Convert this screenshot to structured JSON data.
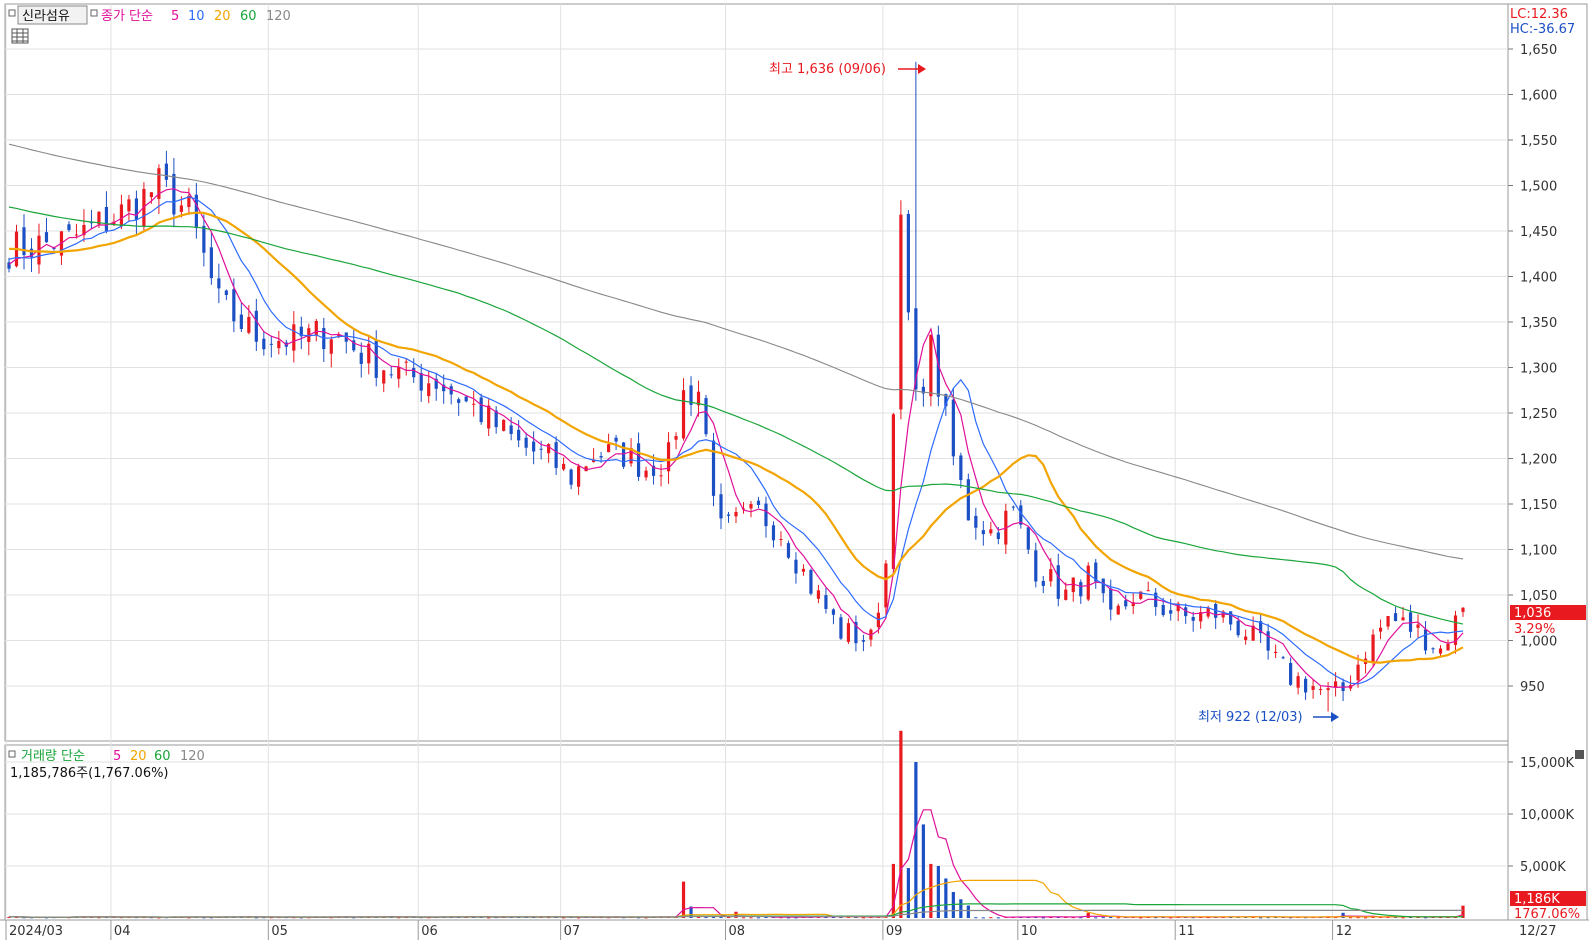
{
  "header": {
    "stock_name": "신라섬유",
    "price_legend": {
      "label": "종가 단순",
      "periods": [
        "5",
        "10",
        "20",
        "60",
        "120"
      ]
    },
    "lc": "LC:12.36",
    "hc": "HC:-36.67"
  },
  "volume_header": {
    "label": "거래량 단순",
    "periods": [
      "5",
      "20",
      "60",
      "120"
    ],
    "total": "1,185,786주(1,767.06%)"
  },
  "annotations": {
    "high": "최고 1,636 (09/06)",
    "low": "최저 922 (12/03)"
  },
  "current": {
    "price": "1,036",
    "change": "3.29%",
    "volume": "1,186K",
    "volume_pct": "1767.06%"
  },
  "colors": {
    "up": "#e8191f",
    "down": "#1b4fc4",
    "ma5": "#e0109a",
    "ma10": "#2d6bff",
    "ma20": "#f2a400",
    "ma60": "#1aa53a",
    "ma120": "#888888"
  },
  "chart_data": [
    {
      "type": "candlestick",
      "yticks": [
        "1,650",
        "1,600",
        "1,550",
        "1,500",
        "1,450",
        "1,400",
        "1,350",
        "1,300",
        "1,250",
        "1,200",
        "1,150",
        "1,100",
        "1,050",
        "1,000",
        "950"
      ],
      "ylim": [
        900,
        1680
      ],
      "xticks": [
        "2024/03",
        "04",
        "05",
        "06",
        "07",
        "08",
        "09",
        "10",
        "11",
        "12",
        "12/27"
      ],
      "high": 1636,
      "low": 922,
      "last": 1036,
      "close_path": [
        [
          0,
          1430
        ],
        [
          8,
          1440
        ],
        [
          15,
          1470
        ],
        [
          20,
          1500
        ],
        [
          24,
          1470
        ],
        [
          28,
          1370
        ],
        [
          33,
          1335
        ],
        [
          38,
          1330
        ],
        [
          43,
          1340
        ],
        [
          48,
          1310
        ],
        [
          53,
          1290
        ],
        [
          57,
          1285
        ],
        [
          63,
          1250
        ],
        [
          68,
          1215
        ],
        [
          72,
          1200
        ],
        [
          75,
          1180
        ],
        [
          78,
          1205
        ],
        [
          82,
          1205
        ],
        [
          85,
          1190
        ],
        [
          88,
          1200
        ],
        [
          90,
          1270
        ],
        [
          92,
          1275
        ],
        [
          95,
          1120
        ],
        [
          100,
          1140
        ],
        [
          103,
          1120
        ],
        [
          107,
          1060
        ],
        [
          111,
          1010
        ],
        [
          115,
          1000
        ],
        [
          117,
          1085
        ],
        [
          119,
          1450
        ],
        [
          121,
          1260
        ],
        [
          123,
          1320
        ],
        [
          126,
          1200
        ],
        [
          128,
          1140
        ],
        [
          131,
          1120
        ],
        [
          134,
          1140
        ],
        [
          137,
          1080
        ],
        [
          141,
          1050
        ],
        [
          144,
          1070
        ],
        [
          147,
          1020
        ],
        [
          150,
          1050
        ],
        [
          153,
          1040
        ],
        [
          157,
          1025
        ],
        [
          161,
          1030
        ],
        [
          165,
          1010
        ],
        [
          168,
          985
        ],
        [
          171,
          960
        ],
        [
          174,
          950
        ],
        [
          176,
          940
        ],
        [
          178,
          945
        ],
        [
          181,
          990
        ],
        [
          184,
          1025
        ],
        [
          188,
          1010
        ],
        [
          191,
          990
        ],
        [
          194,
          1036
        ]
      ],
      "ma_series": [
        {
          "name": "5",
          "color": "#e0109a"
        },
        {
          "name": "10",
          "color": "#2d6bff"
        },
        {
          "name": "20",
          "color": "#f2a400"
        },
        {
          "name": "60",
          "color": "#1aa53a"
        },
        {
          "name": "120",
          "color": "#888888"
        }
      ]
    },
    {
      "type": "bar",
      "name": "volume",
      "yticks": [
        "15,000K",
        "10,000K",
        "5,000K"
      ],
      "ylim": [
        0,
        18500
      ],
      "spikes": [
        [
          90,
          3500
        ],
        [
          91,
          1100
        ],
        [
          97,
          600
        ],
        [
          118,
          5200
        ],
        [
          119,
          18000
        ],
        [
          120,
          4800
        ],
        [
          121,
          15000
        ],
        [
          122,
          9000
        ],
        [
          123,
          5200
        ],
        [
          124,
          5000
        ],
        [
          125,
          3800
        ],
        [
          126,
          2500
        ],
        [
          127,
          1800
        ],
        [
          128,
          1200
        ],
        [
          144,
          500
        ],
        [
          178,
          500
        ],
        [
          194,
          1186
        ]
      ],
      "ma_series": [
        {
          "name": "5",
          "color": "#e0109a"
        },
        {
          "name": "20",
          "color": "#f2a400"
        },
        {
          "name": "60",
          "color": "#1aa53a"
        },
        {
          "name": "120",
          "color": "#888888"
        }
      ]
    }
  ]
}
